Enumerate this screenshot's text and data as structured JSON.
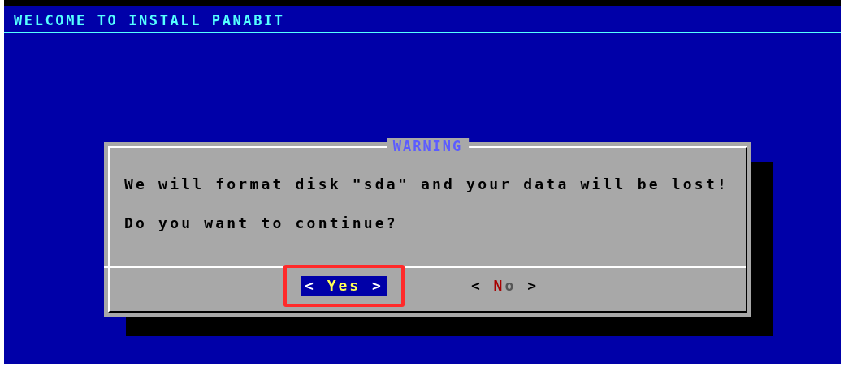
{
  "screen_title": "WELCOME TO INSTALL PANABIT",
  "dialog": {
    "title": "WARNING",
    "lines": [
      "We will format disk \"sda\" and your data will be lost!",
      "Do you want to continue?"
    ],
    "buttons": [
      {
        "open": "<",
        "hotkey": "Y",
        "rest": "es",
        "close": ">",
        "selected": true,
        "annotated": true
      },
      {
        "open": "<",
        "hotkey": "N",
        "rest": "o",
        "close": ">",
        "selected": false,
        "annotated": false
      }
    ]
  }
}
